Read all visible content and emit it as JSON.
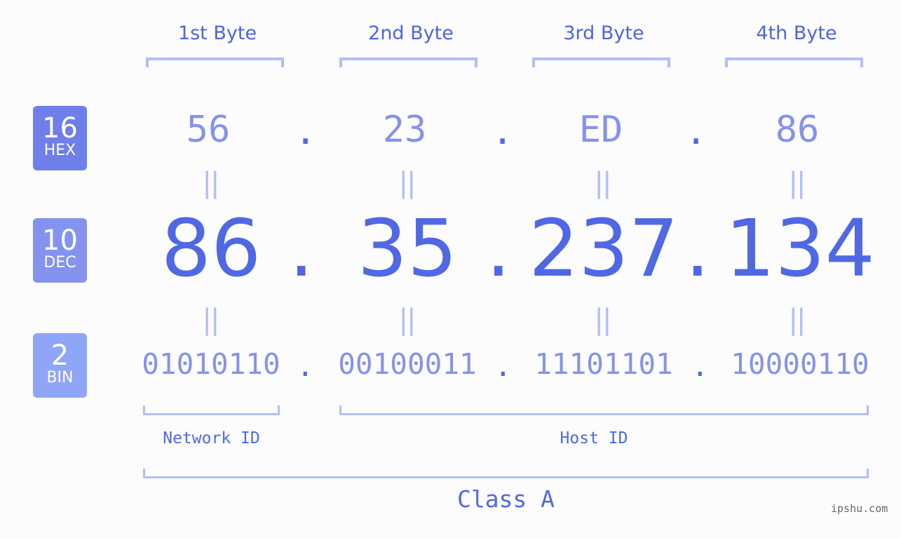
{
  "bytes": {
    "labels": [
      "1st Byte",
      "2nd Byte",
      "3rd Byte",
      "4th Byte"
    ]
  },
  "badges": {
    "hex": {
      "num": "16",
      "label": "HEX",
      "color": "#6e7feb"
    },
    "dec": {
      "num": "10",
      "label": "DEC",
      "color": "#8493f0"
    },
    "bin": {
      "num": "2",
      "label": "BIN",
      "color": "#8fa5f7"
    }
  },
  "hex": [
    "56",
    "23",
    "ED",
    "86"
  ],
  "dec": [
    "86",
    "35",
    "237",
    "134"
  ],
  "bin": [
    "01010110",
    "00100011",
    "11101101",
    "10000110"
  ],
  "separator": ".",
  "equals": "||",
  "network_id": "Network ID",
  "host_id": "Host ID",
  "class_label": "Class A",
  "watermark": "ipshu.com",
  "colors": {
    "accent": "#5068e4",
    "light": "#8592ec",
    "bracket": "#b3bdf7"
  }
}
